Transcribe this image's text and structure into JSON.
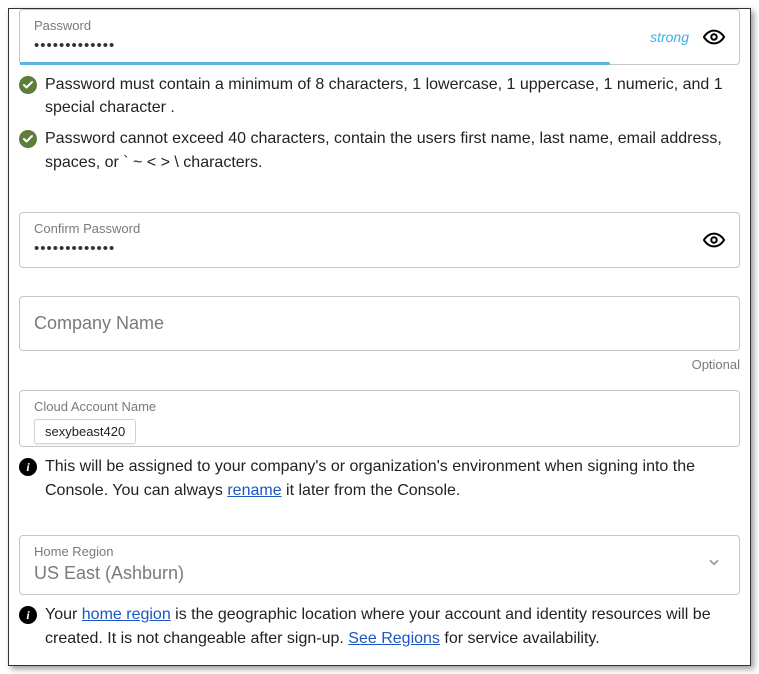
{
  "password": {
    "label": "Password",
    "value": "•••••••••••••",
    "strength": "strong"
  },
  "requirements": {
    "r1": "Password must contain a minimum of 8 characters, 1 lowercase, 1 uppercase, 1 numeric, and 1 special character .",
    "r2": "Password cannot exceed 40 characters, contain the users first name, last name, email address, spaces, or ` ~ < > \\ characters."
  },
  "confirm": {
    "label": "Confirm Password",
    "value": "•••••••••••••"
  },
  "company": {
    "placeholder": "Company Name",
    "optional": "Optional"
  },
  "cloudacct": {
    "label": "Cloud Account Name",
    "autofill": "sexybeast420",
    "help_pre": "This will be assigned to your company's or organization's environment when signing into the Console. You can always ",
    "rename": "rename",
    "help_post": " it later from the Console."
  },
  "region": {
    "label": "Home Region",
    "value": "US East (Ashburn)",
    "help_pre": "Your ",
    "home_region": "home region",
    "help_mid": " is the geographic location where your account and identity resources will be created. It is not changeable after sign-up. ",
    "see_regions": "See Regions",
    "help_post": " for service availability."
  }
}
